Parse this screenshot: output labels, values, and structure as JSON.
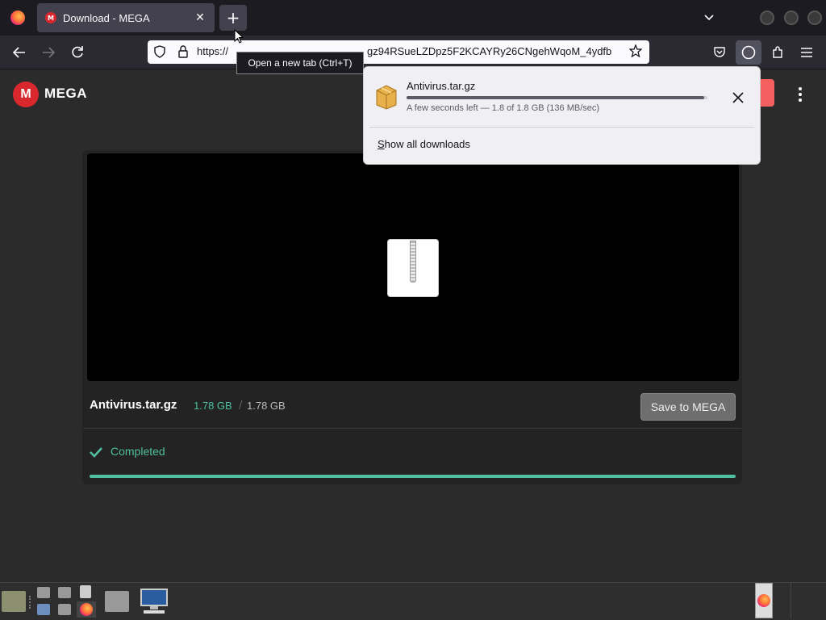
{
  "browser": {
    "tab_title": "Download - MEGA",
    "new_tab_symbol": "+",
    "tab_close_symbol": "✕",
    "tooltip": "Open a new tab (Ctrl+T)",
    "url": "https://mega.nz/file/...gz94RSueLZDpz5F2KCAYRy26CNgehWqoM_4ydfb",
    "url_visible": "https://",
    "url_visible_tail": "gz94RSueLZDpz5F2KCAYRy26CNgehWqoM_4ydfb"
  },
  "mega": {
    "logo_letter": "M",
    "brand": "MEGA",
    "file_name": "Antivirus.tar.gz",
    "size_downloaded": "1.78 GB",
    "size_separator": "/",
    "size_total": "1.78 GB",
    "save_button": "Save to MEGA",
    "status": "Completed",
    "progress": 1.0,
    "accent": "#4fbf9f",
    "brand_color": "#d9272e"
  },
  "downloads_panel": {
    "file_name": "Antivirus.tar.gz",
    "status": "A few seconds left — 1.8 of 1.8 GB (136 MB/sec)",
    "progress": 0.99,
    "show_all": "Show all downloads"
  }
}
